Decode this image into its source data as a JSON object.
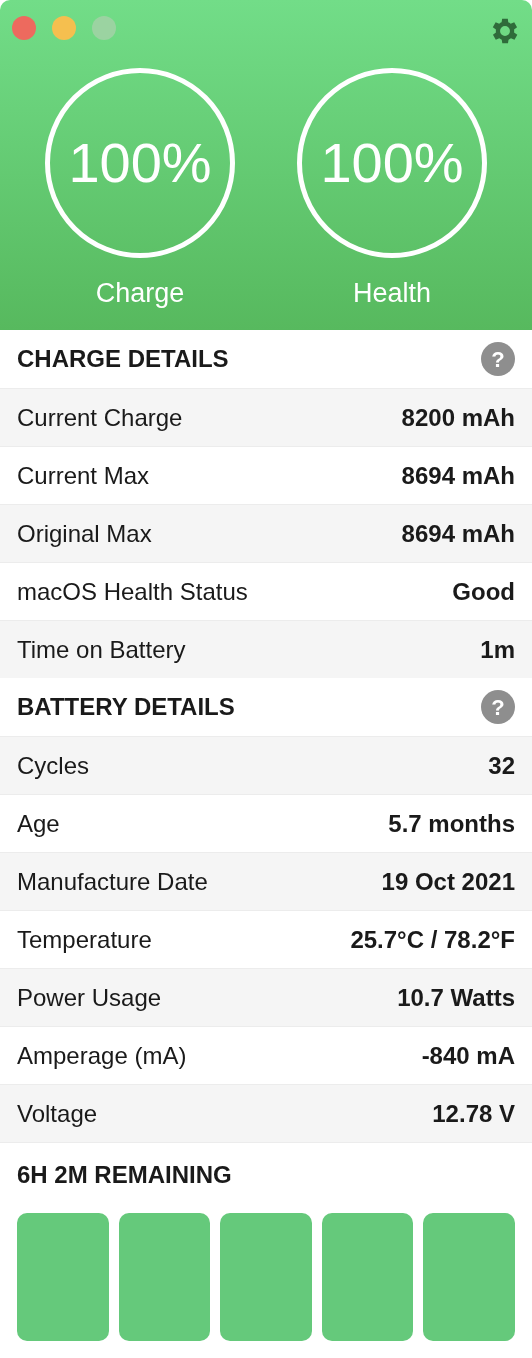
{
  "window_buttons": [
    {
      "color": "#ed6a5e"
    },
    {
      "color": "#f5bf4f"
    },
    {
      "color": "#9bd3a1"
    }
  ],
  "gauges": [
    {
      "value": "100%",
      "label": "Charge"
    },
    {
      "value": "100%",
      "label": "Health"
    }
  ],
  "sections": [
    {
      "title": "CHARGE DETAILS",
      "help": "?",
      "rows": [
        {
          "label": "Current Charge",
          "value": "8200 mAh"
        },
        {
          "label": "Current Max",
          "value": "8694 mAh"
        },
        {
          "label": "Original Max",
          "value": "8694 mAh"
        },
        {
          "label": "macOS Health Status",
          "value": "Good"
        },
        {
          "label": "Time on Battery",
          "value": "1m"
        }
      ]
    },
    {
      "title": "BATTERY DETAILS",
      "help": "?",
      "rows": [
        {
          "label": "Cycles",
          "value": "32"
        },
        {
          "label": "Age",
          "value": "5.7 months"
        },
        {
          "label": "Manufacture Date",
          "value": "19 Oct 2021"
        },
        {
          "label": "Temperature",
          "value": "25.7°C / 78.2°F"
        },
        {
          "label": "Power Usage",
          "value": "10.7 Watts"
        },
        {
          "label": "Amperage (mA)",
          "value": "-840 mA"
        },
        {
          "label": "Voltage",
          "value": "12.78 V"
        }
      ]
    }
  ],
  "remaining": {
    "title": "6H 2M REMAINING",
    "segments": [
      {
        "filled": true
      },
      {
        "filled": true
      },
      {
        "filled": true
      },
      {
        "filled": true
      },
      {
        "filled": true
      }
    ]
  }
}
